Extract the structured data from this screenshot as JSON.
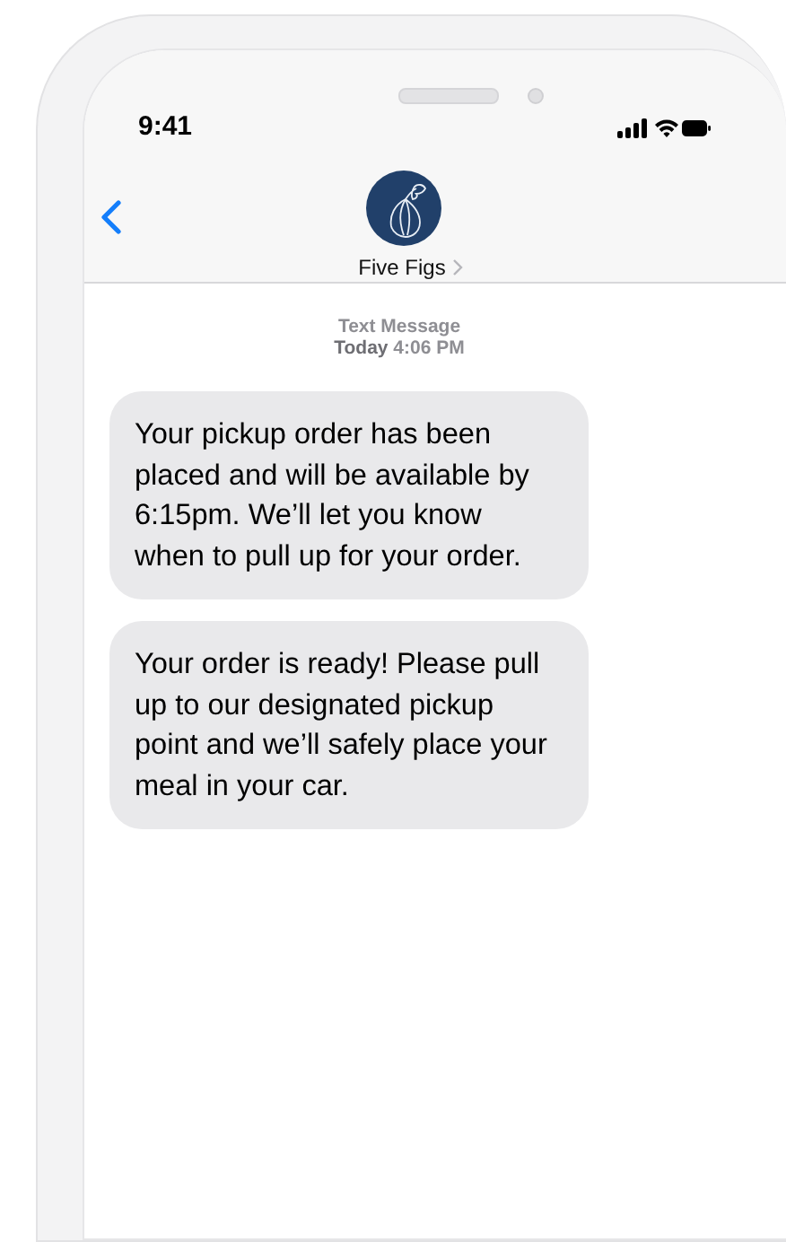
{
  "status_bar": {
    "time": "9:41"
  },
  "contact": {
    "name": "Five Figs"
  },
  "timestamp": {
    "label": "Text Message",
    "when": "**Today** 4:06 PM"
  },
  "messages": [
    {
      "text": "Your pickup order has been placed and will be available by 6:15pm. We’ll let you know when to pull up for your order."
    },
    {
      "text": "Your order is ready! Please pull up to our designated pickup point and we’ll safely place your meal in your car."
    }
  ]
}
